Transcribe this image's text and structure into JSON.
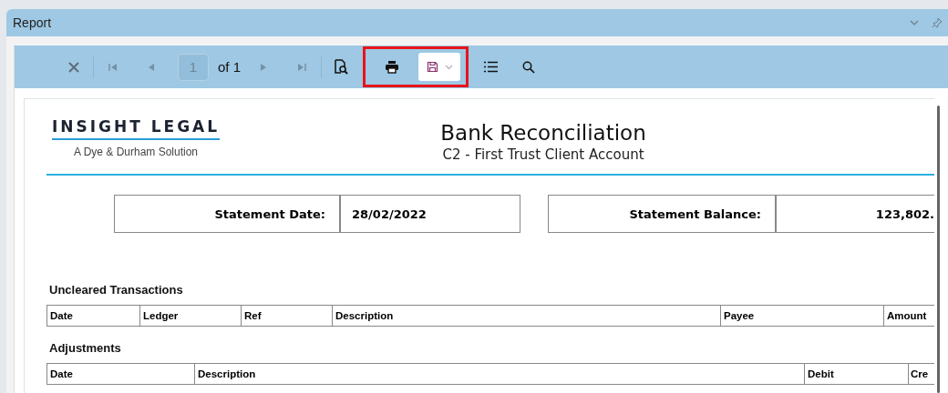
{
  "window": {
    "title": "Report"
  },
  "toolbar": {
    "groups": [
      {
        "highlighted": false,
        "items": [
          {
            "kind": "close",
            "disabled": false
          },
          {
            "kind": "sep"
          },
          {
            "kind": "first",
            "disabled": true
          },
          {
            "kind": "prev",
            "disabled": true
          },
          {
            "kind": "page",
            "value": "1",
            "disabled": true
          },
          {
            "kind": "label",
            "text": "of 1"
          },
          {
            "kind": "next",
            "disabled": true
          },
          {
            "kind": "last",
            "disabled": true
          },
          {
            "kind": "sep"
          },
          {
            "kind": "export",
            "disabled": false
          }
        ]
      },
      {
        "highlighted": true,
        "items": [
          {
            "kind": "print",
            "disabled": false
          },
          {
            "kind": "save",
            "disabled": false
          }
        ]
      },
      {
        "highlighted": false,
        "items": [
          {
            "kind": "list",
            "disabled": false
          },
          {
            "kind": "search",
            "disabled": false
          }
        ]
      }
    ]
  },
  "report": {
    "logo": "INSIGHT LEGAL",
    "tagline": "A Dye & Durham Solution",
    "title": "Bank Reconciliation",
    "subtitle": "C2 - First Trust Client Account",
    "fields": [
      {
        "label": "Statement Date:",
        "value": "28/02/2022",
        "kind": "date"
      },
      {
        "label": "Statement Balance:",
        "value": "123,802.",
        "kind": "amount"
      }
    ],
    "sections": [
      {
        "title": "Uncleared Transactions",
        "columns": [
          {
            "label": "Date"
          },
          {
            "label": "Ledger"
          },
          {
            "label": "Ref"
          },
          {
            "label": "Description"
          },
          {
            "label": "Payee"
          },
          {
            "label": "Amount"
          }
        ]
      },
      {
        "title": "Adjustments",
        "columns": [
          {
            "label": "Date"
          },
          {
            "label": "Description"
          },
          {
            "label": "Debit"
          },
          {
            "label": "Cre"
          }
        ]
      }
    ]
  }
}
